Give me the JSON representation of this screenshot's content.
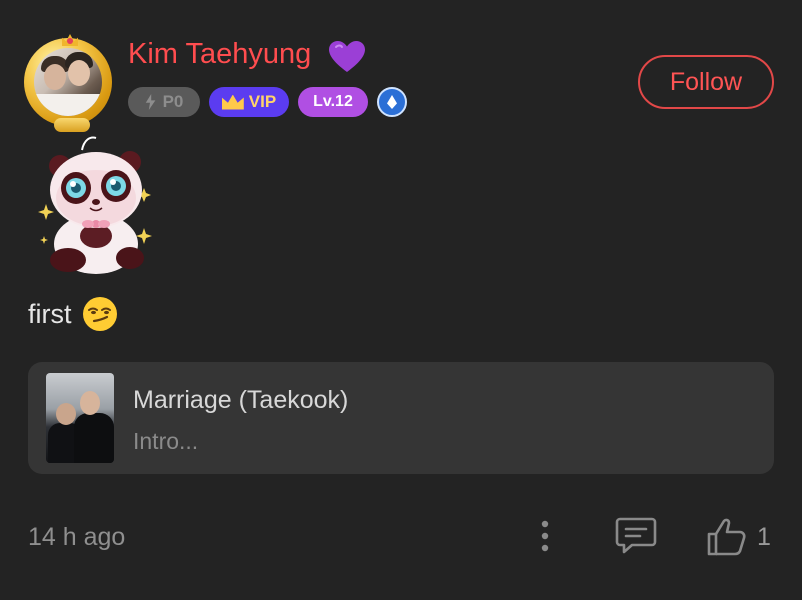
{
  "post": {
    "username": "Kim Taehyung",
    "badges": {
      "points": "P0",
      "vip": "VIP",
      "level": "Lv.12"
    },
    "follow_label": "Follow",
    "comment_text": "first",
    "book": {
      "title": "Marriage (Taekook)",
      "subtitle": "Intro..."
    },
    "timestamp": "14 h ago",
    "like_count": "1"
  },
  "icons": {
    "username_emoji": "purple-heart-icon",
    "comment_emoji": "smirk-emoji-icon",
    "more": "more-vertical-icon",
    "comment": "comment-icon",
    "like": "thumbs-up-icon"
  },
  "colors": {
    "background": "#232323",
    "username": "#ff4d4f",
    "follow_border": "#e24848",
    "vip_badge": "#5b3cf0",
    "level_badge": "#b04fe3",
    "card": "#353535"
  }
}
